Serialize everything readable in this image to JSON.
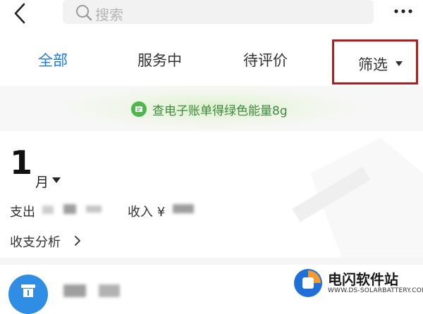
{
  "header": {
    "search_placeholder": "搜索"
  },
  "tabs": [
    {
      "label": "全部",
      "active": true
    },
    {
      "label": "服务中",
      "active": false
    },
    {
      "label": "待评价",
      "active": false
    }
  ],
  "filter": {
    "label": "筛选"
  },
  "banner": {
    "text": "查电子账单得绿色能量8g",
    "icon": "leaf-bill-icon"
  },
  "period": {
    "month": "1",
    "unit": "月"
  },
  "summary": {
    "expense_label": "支出",
    "income_label": "收入 ¥"
  },
  "analysis": {
    "label": "收支分析"
  },
  "watermark": {
    "title": "电闪软件站",
    "url": "WWW.DS-SOLARBATTERY.COM"
  },
  "colors": {
    "accent": "#1b79ea",
    "highlight_border": "#b21c1c",
    "banner_green": "#3f8a3f",
    "record_icon_bg": "#2f8de4"
  }
}
